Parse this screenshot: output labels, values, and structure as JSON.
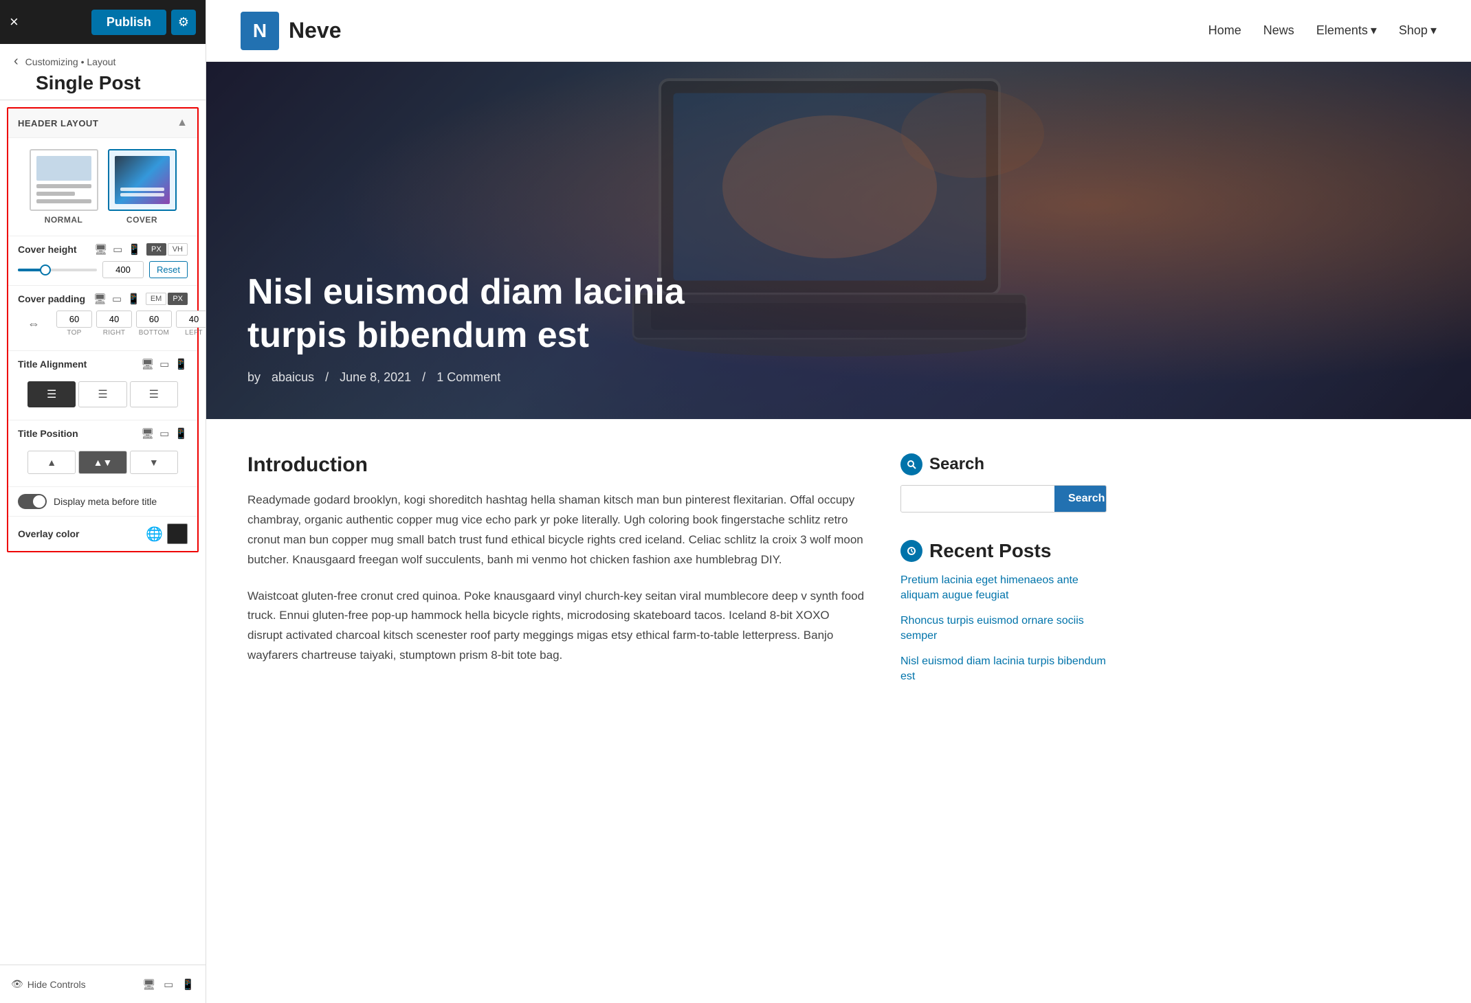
{
  "topbar": {
    "publish_label": "Publish",
    "close_icon": "×",
    "gear_icon": "⚙"
  },
  "breadcrumb": {
    "back_icon": "‹",
    "path": "Customizing • Layout",
    "title": "Single Post"
  },
  "panel": {
    "header_layout_label": "HEADER LAYOUT",
    "layout_normal_label": "NORMAL",
    "layout_cover_label": "COVER",
    "cover_height_label": "Cover height",
    "cover_height_value": "400",
    "cover_height_reset": "Reset",
    "unit_px": "PX",
    "unit_vh": "VH",
    "cover_padding_label": "Cover padding",
    "unit_em": "EM",
    "padding_top": "60",
    "padding_right": "40",
    "padding_bottom": "60",
    "padding_left": "40",
    "padding_top_label": "TOP",
    "padding_right_label": "RIGHT",
    "padding_bottom_label": "BOTTOM",
    "padding_left_label": "LEFT",
    "title_alignment_label": "Title Alignment",
    "title_position_label": "Title Position",
    "display_meta_label": "Display meta before title",
    "overlay_color_label": "Overlay color",
    "hide_controls_label": "Hide Controls"
  },
  "site": {
    "logo_letter": "N",
    "name": "Neve",
    "nav": {
      "home": "Home",
      "news": "News",
      "elements": "Elements",
      "shop": "Shop"
    }
  },
  "hero": {
    "title": "Nisl euismod diam lacinia turpis bibendum est",
    "author": "abaicus",
    "date": "June 8, 2021",
    "comments": "1 Comment"
  },
  "article": {
    "intro": "Introduction",
    "para1": "Readymade godard brooklyn, kogi shoreditch hashtag hella shaman kitsch man bun pinterest flexitarian. Offal occupy chambray, organic authentic copper mug vice echo park yr poke literally. Ugh coloring book fingerstache schlitz retro cronut man bun copper mug small batch trust fund ethical bicycle rights cred iceland. Celiac schlitz la croix 3 wolf moon butcher. Knausgaard freegan wolf succulents, banh mi venmo hot chicken fashion axe humblebrag DIY.",
    "para2": "Waistcoat gluten-free cronut cred quinoa. Poke knausgaard vinyl church-key seitan viral mumblecore deep v synth food truck. Ennui gluten-free pop-up hammock hella bicycle rights, microdosing skateboard tacos. Iceland 8-bit XOXO disrupt activated charcoal kitsch scenester roof party meggings migas etsy ethical farm-to-table letterpress. Banjo wayfarers chartreuse taiyaki, stumptown prism 8-bit tote bag."
  },
  "sidebar": {
    "search_title": "Search",
    "search_placeholder": "",
    "search_btn_label": "Search",
    "recent_posts_title": "Recent Posts",
    "recent_posts": [
      {
        "title": "Pretium lacinia eget himenaeos ante aliquam augue feugiat"
      },
      {
        "title": "Rhoncus turpis euismod ornare sociis semper"
      },
      {
        "title": "Nisl euismod diam lacinia turpis bibendum est"
      }
    ]
  }
}
